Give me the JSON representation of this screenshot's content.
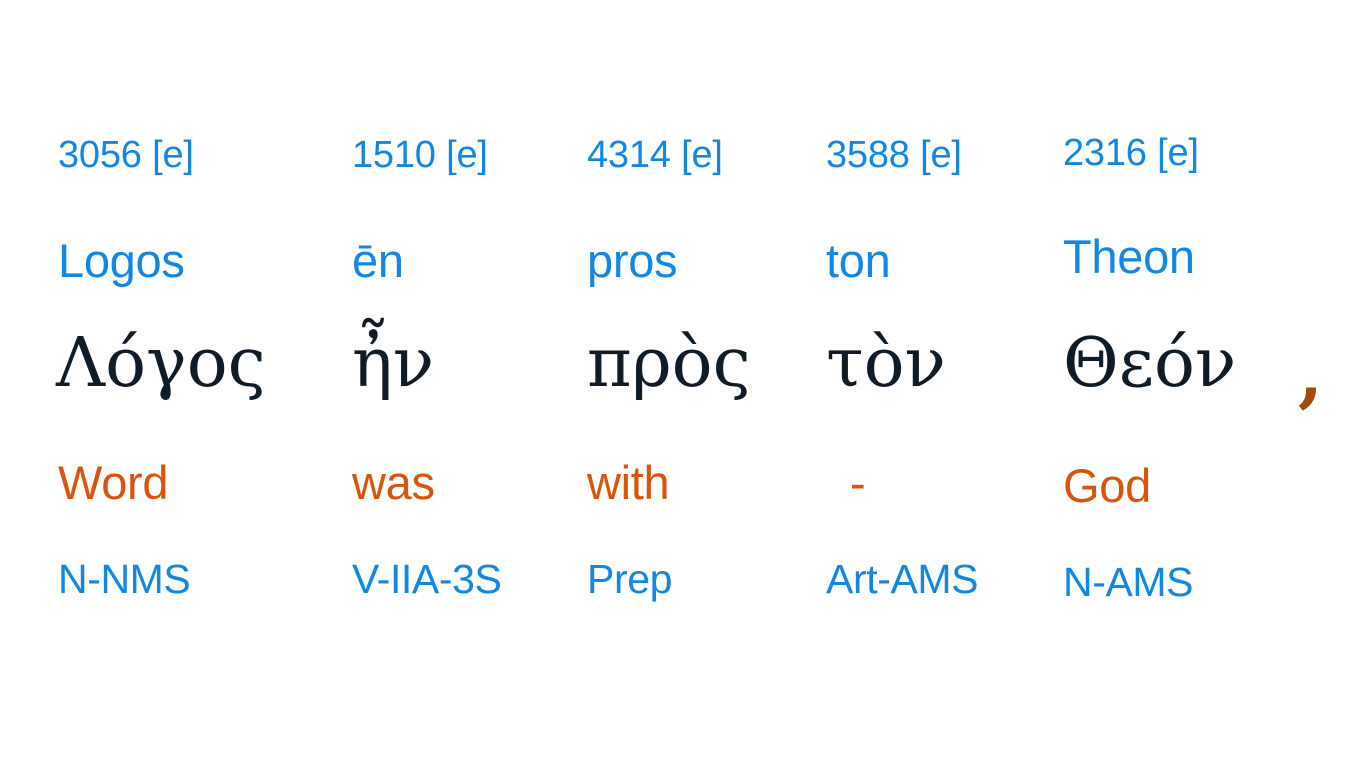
{
  "page": {
    "background_color": "#ffffff",
    "layout": "interlinear-word-columns",
    "row_labels": [
      "strongs",
      "transliteration",
      "greek",
      "gloss",
      "parsing"
    ]
  },
  "colors": {
    "blue": "#1288e6",
    "orange": "#d9550b",
    "dark_orange": "#a34a06",
    "greek_dark": "#101b28"
  },
  "columns": [
    {
      "strongs": "3056 [e]",
      "translit": "Logos",
      "greek": "Λόγος",
      "gloss": "Word",
      "parsing": "N-NMS"
    },
    {
      "strongs": "1510 [e]",
      "translit": "ēn",
      "greek": "ἦν",
      "gloss": "was",
      "parsing": "V-IIA-3S"
    },
    {
      "strongs": "4314 [e]",
      "translit": "pros",
      "greek": "πρὸς",
      "gloss": "with",
      "parsing": "Prep"
    },
    {
      "strongs": "3588 [e]",
      "translit": "ton",
      "greek": "τὸν",
      "gloss": "-",
      "parsing": "Art-AMS"
    },
    {
      "strongs": "2316 [e]",
      "translit": "Theon",
      "greek": "Θεόν",
      "gloss": "God",
      "parsing": "N-AMS"
    }
  ],
  "trailing_punctuation": ","
}
